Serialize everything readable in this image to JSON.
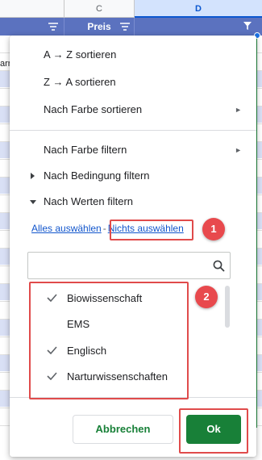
{
  "sheet": {
    "columns": [
      "C",
      "D"
    ],
    "header_label": "Preis",
    "edge_text": "arr"
  },
  "menu": {
    "sort_az": "A → Z sortieren",
    "sort_za": "Z → A sortieren",
    "sort_color": "Nach Farbe sortieren",
    "filter_color": "Nach Farbe filtern",
    "filter_condition": "Nach Bedingung filtern",
    "filter_values": "Nach Werten filtern",
    "select_all": "Alles auswählen",
    "separator": "-",
    "select_none": "Nichts auswählen",
    "search_placeholder": "",
    "values": [
      {
        "label": "Biowissenschaft",
        "checked": true
      },
      {
        "label": "EMS",
        "checked": false
      },
      {
        "label": "Englisch",
        "checked": true
      },
      {
        "label": "Narturwissenschaften",
        "checked": true
      }
    ],
    "cancel_label": "Abbrechen",
    "ok_label": "Ok"
  },
  "annotations": {
    "badge_1": "1",
    "badge_2": "2"
  },
  "colors": {
    "header_blue": "#5b72bf",
    "ok_green": "#188038",
    "link_blue": "#1155cc",
    "annotation_red": "#e04b4b"
  }
}
